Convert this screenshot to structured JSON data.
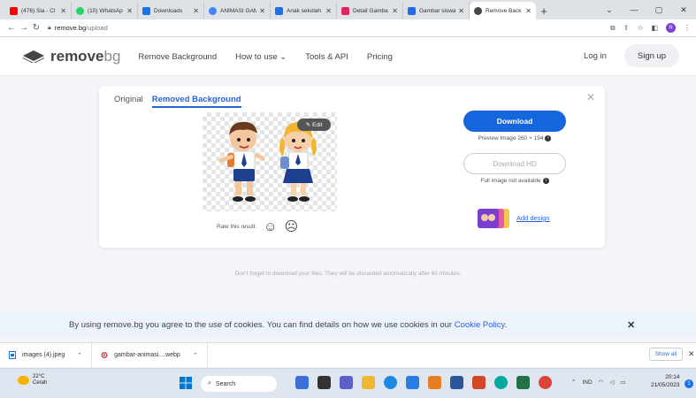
{
  "browser": {
    "tabs": [
      {
        "title": "(476) Sia - Cl",
        "color": "#ff0000"
      },
      {
        "title": "(10) WhatsAp",
        "color": "#25d366"
      },
      {
        "title": "Downloads",
        "color": "#1a73e8"
      },
      {
        "title": "ANIMASI GAM",
        "color": "#4285f4"
      },
      {
        "title": "Anak sekolah",
        "color": "#1f6feb"
      },
      {
        "title": "Detail Gamba",
        "color": "#e0245e"
      },
      {
        "title": "Gambar siswa",
        "color": "#1f6feb"
      },
      {
        "title": "Remove Back",
        "color": "#454545"
      }
    ],
    "url_domain": "remove.bg",
    "url_path": "/upload",
    "profile_initial": "R"
  },
  "site": {
    "logo_text": "remove",
    "logo_suffix": "bg",
    "nav": [
      "Remove Background",
      "How to use",
      "Tools & API",
      "Pricing"
    ],
    "login": "Log in",
    "signup": "Sign up"
  },
  "card": {
    "tabs": {
      "original": "Original",
      "removed": "Removed Background"
    },
    "edit_label": "Edit",
    "rate_label": "Rate this result:",
    "download_label": "Download",
    "preview_info": "Preview Image 260 × 194",
    "download_hd_label": "Download HD",
    "hd_info": "Full image not available",
    "add_design_label": "Add design"
  },
  "notice": "Don't forget to download your files. They will be discarded automatically after 60 minutes.",
  "cookie": {
    "text": "By using remove.bg you agree to the use of cookies. You can find details on how we use cookies in our",
    "link": "Cookie Policy",
    "end": "."
  },
  "downloads": {
    "items": [
      {
        "name": "images (4).jpeg"
      },
      {
        "name": "gambar-animasi....webp"
      }
    ],
    "show_all": "Show all"
  },
  "taskbar": {
    "temp": "22°C",
    "weather": "Cerah",
    "search": "Search",
    "lang": "IND",
    "time": "20:14",
    "date": "21/05/2023",
    "notif_count": "1"
  }
}
